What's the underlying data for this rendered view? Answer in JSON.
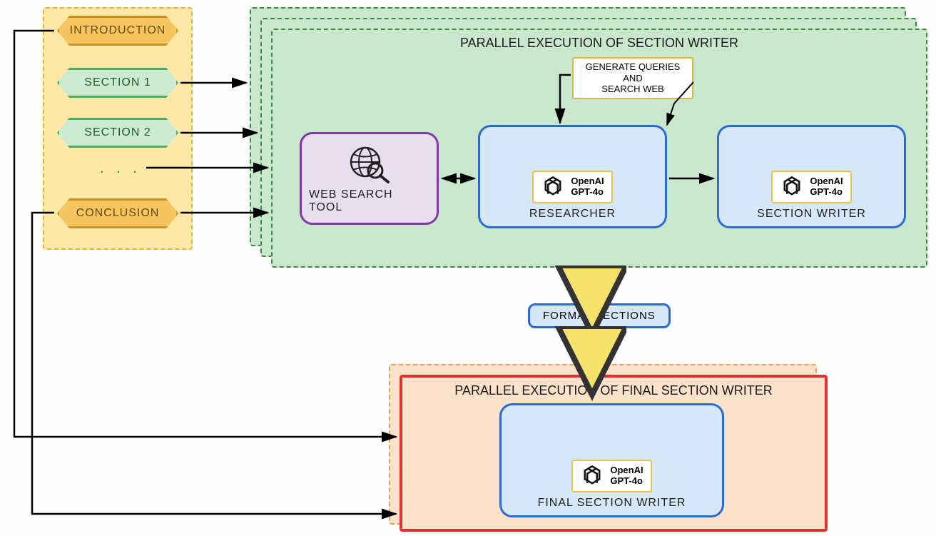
{
  "sections": {
    "introduction": "INTRODUCTION",
    "section1": "SECTION 1",
    "section2": "SECTION 2",
    "dots": ". . .",
    "conclusion": "CONCLUSION"
  },
  "green_panel": {
    "title": "PARALLEL EXECUTION OF SECTION WRITER",
    "note": "GENERATE QUERIES\nAND\nSEARCH WEB",
    "web_search": "WEB SEARCH TOOL",
    "researcher": "RESEARCHER",
    "section_writer": "SECTION WRITER"
  },
  "model": {
    "line1": "OpenAI",
    "line2": "GPT-4o"
  },
  "format_sections": "FORMAT SECTIONS",
  "orange_panel": {
    "title": "PARALLEL EXECUTION OF FINAL SECTION WRITER",
    "final_writer": "FINAL SECTION WRITER"
  }
}
